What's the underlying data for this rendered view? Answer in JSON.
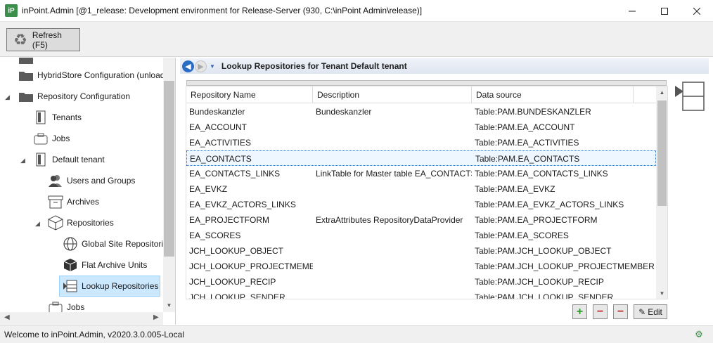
{
  "window": {
    "app_icon": "iP",
    "title": "inPoint.Admin [@1_release: Development environment for Release-Server (930, C:\\inPoint Admin\\release)]",
    "minimize_icon": "minimize-icon",
    "maximize_icon": "maximize-icon",
    "close_icon": "close-icon"
  },
  "toolbar": {
    "refresh_label": "Refresh (F5)"
  },
  "tree": {
    "items": [
      {
        "label": "HybridStore Configuration (unloaded)",
        "icon": "folder-icon"
      },
      {
        "label": "Repository Configuration",
        "icon": "folder-icon",
        "expanded": true
      },
      {
        "label": "Tenants",
        "icon": "tenant-icon"
      },
      {
        "label": "Jobs",
        "icon": "jobs-icon"
      },
      {
        "label": "Default tenant",
        "icon": "tenant-icon",
        "expanded": true
      },
      {
        "label": "Users and Groups",
        "icon": "users-icon"
      },
      {
        "label": "Archives",
        "icon": "archive-icon"
      },
      {
        "label": "Repositories",
        "icon": "cube-icon",
        "expanded": true
      },
      {
        "label": "Global Site Repositories",
        "icon": "globe-icon"
      },
      {
        "label": "Flat Archive Units",
        "icon": "box-icon"
      },
      {
        "label": "Lookup Repositories",
        "icon": "lookup-icon",
        "selected": true
      },
      {
        "label": "Jobs",
        "icon": "jobs-icon"
      }
    ]
  },
  "content": {
    "nav_title": "Lookup Repositories for Tenant Default tenant",
    "columns": [
      "Repository Name",
      "Description",
      "Data source"
    ],
    "rows": [
      {
        "name": "Bundeskanzler",
        "description": "Bundeskanzler",
        "source": "Table:PAM.BUNDESKANZLER"
      },
      {
        "name": "EA_ACCOUNT",
        "description": "",
        "source": "Table:PAM.EA_ACCOUNT"
      },
      {
        "name": "EA_ACTIVITIES",
        "description": "",
        "source": "Table:PAM.EA_ACTIVITIES"
      },
      {
        "name": "EA_CONTACTS",
        "description": "",
        "source": "Table:PAM.EA_CONTACTS",
        "selected": true
      },
      {
        "name": "EA_CONTACTS_LINKS",
        "description": "LinkTable for Master table EA_CONTACTS",
        "source": "Table:PAM.EA_CONTACTS_LINKS"
      },
      {
        "name": "EA_EVKZ",
        "description": "",
        "source": "Table:PAM.EA_EVKZ"
      },
      {
        "name": "EA_EVKZ_ACTORS_LINKS",
        "description": "",
        "source": "Table:PAM.EA_EVKZ_ACTORS_LINKS"
      },
      {
        "name": "EA_PROJECTFORM",
        "description": "ExtraAttributes RepositoryDataProvider",
        "source": "Table:PAM.EA_PROJECTFORM"
      },
      {
        "name": "EA_SCORES",
        "description": "",
        "source": "Table:PAM.EA_SCORES"
      },
      {
        "name": "JCH_LOOKUP_OBJECT",
        "description": "",
        "source": "Table:PAM.JCH_LOOKUP_OBJECT"
      },
      {
        "name": "JCH_LOOKUP_PROJECTMEMBER",
        "description": "",
        "source": "Table:PAM.JCH_LOOKUP_PROJECTMEMBER"
      },
      {
        "name": "JCH_LOOKUP_RECIP",
        "description": "",
        "source": "Table:PAM.JCH_LOOKUP_RECIP"
      },
      {
        "name": "JCH_LOOKUP_SENDER",
        "description": "",
        "source": "Table:PAM.JCH_LOOKUP_SENDER"
      }
    ],
    "actions": {
      "add": "+",
      "remove": "−",
      "remove_all": "−",
      "edit_label": "Edit"
    }
  },
  "status": {
    "text": "Welcome to inPoint.Admin, v2020.3.0.005-Local"
  },
  "colors": {
    "accent": "#2b6cc4",
    "add_green": "#2e9a2e",
    "remove_red": "#c42b2b",
    "selection": "#cce8ff"
  }
}
